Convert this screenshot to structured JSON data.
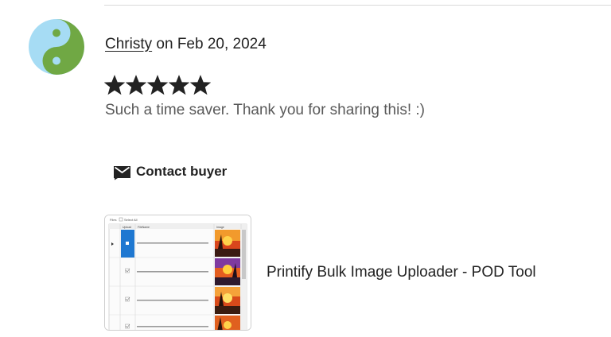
{
  "review": {
    "reviewer_name": "Christy",
    "date_text": "on Feb 20, 2024",
    "rating": 5,
    "rating_max": 5,
    "text": "Such a time saver. Thank you for sharing this! :)",
    "avatar_icon": "yin-yang-icon"
  },
  "actions": {
    "contact_label": "Contact buyer",
    "contact_icon": "envelope-icon"
  },
  "listing": {
    "title": "Printify Bulk Image Uploader - POD Tool",
    "thumbnail_headers": [
      "Upload",
      "FileName",
      "Image"
    ]
  },
  "colors": {
    "avatar_blue": "#a6dcf4",
    "avatar_green": "#70a844",
    "star": "#222222",
    "selected_row": "#1f78d1"
  }
}
